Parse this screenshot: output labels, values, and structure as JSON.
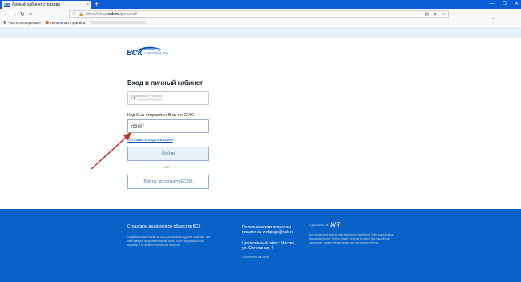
{
  "browser": {
    "tab_title": "Личный кабинет страхова",
    "tab_favicon": "ВСК",
    "url_host": "shop.",
    "url_bold": "vsk.ru",
    "url_prefix": "https://",
    "url_path": "/personal/",
    "bookmarks": [
      {
        "label": "Часто посещаемые",
        "color": "#e3a21a"
      },
      {
        "label": "Начальная страница",
        "color": "#e66000"
      }
    ]
  },
  "logo": {
    "brand": "ВСК",
    "sub": "страховой дом"
  },
  "login": {
    "title": "Вход в личный кабинет",
    "phone_placeholder": "Мобильный телефон",
    "phone_value": "+7",
    "sms_caption": "Код был отправлен Вам по СМС",
    "sms_placeholder": "СМС-код",
    "sms_value": "702664",
    "resend_link": "Отправить код повторно",
    "login_button": "Войти",
    "or_text": "или",
    "esia_button": "Войти, используя ЕСИА"
  },
  "footer": {
    "company": "Страховое акционерное общество ВСК",
    "legal": "Лицензия Банка России № 0621 (бессрочная) и другие лицензии. Вся информация, представленная на сайте, носит информационный характер и не является публичной офертой.",
    "tech_support": "По техническим вопросам пишите на webpage@vsk.ru",
    "office": "Центральный офис: Москва, ул. Островная, 4",
    "map_link": "Посмотреть на карте",
    "made_by": "СДЕЛАНО В",
    "right_text": "Для корректной работы сайта включите JavaScript. Сайт поддерживает браузеры Chrome, Firefox, Safari и Internet Explorer. Настоящий сайт использует сервис веб-аналитики для улучшения работы."
  },
  "colors": {
    "brand_blue": "#0a62c7",
    "accent": "#0b4aa8"
  }
}
